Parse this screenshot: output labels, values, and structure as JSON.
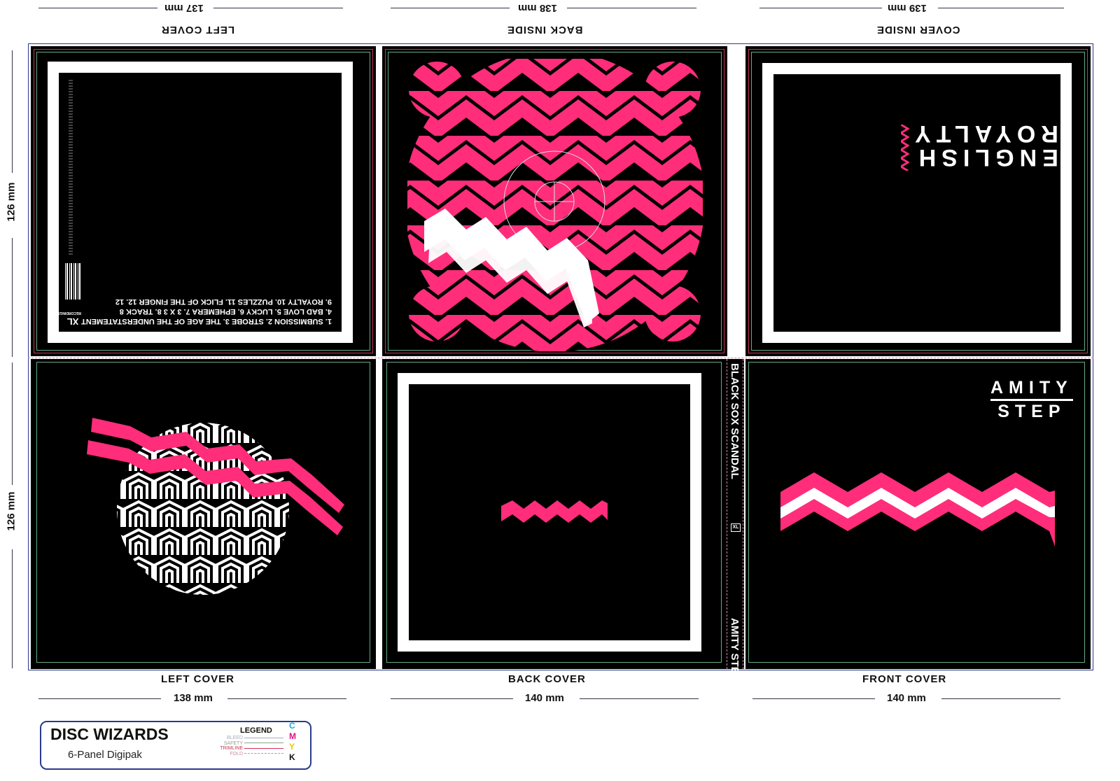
{
  "dimensions": {
    "top": [
      "137 mm",
      "138 mm",
      "139 mm"
    ],
    "bottom": [
      "138 mm",
      "140 mm",
      "140 mm"
    ],
    "side": [
      "126 mm",
      "126 mm"
    ]
  },
  "panel_labels": {
    "top": [
      "LEFT COVER",
      "BACK INSIDE",
      "COVER  INSIDE"
    ],
    "bottom": [
      "LEFT COVER",
      "BACK COVER",
      "FRONT COVER"
    ]
  },
  "tracklist": [
    "1. SUBMISSION   2. STROBE   3. THE AGE OF THE UNDERSTATEMENT",
    "4. BAD LOVE  5. LUCKY  6. EPHEMERA   7. 3 X 3   8. TRACK 8",
    "9. ROYALTY   10. PUZZLES   11. FLICK OF THE FINGER   12. 12"
  ],
  "label_mark": "XL",
  "label_sub": "RECORDINGS",
  "inside_title": [
    "ENGLISH",
    "ROYALTY"
  ],
  "spine": {
    "artist_top": "BLACK SOX SCANDAL",
    "logo": "XL",
    "title_bottom": "AMITY STEP"
  },
  "front_title": [
    "AMITY",
    "STEP"
  ],
  "legend": {
    "brand": "DISC WIZARDS",
    "product": "6-Panel Digipak",
    "heading": "LEGEND",
    "items": [
      "BLEED",
      "SAFETY",
      "TRIMLINE",
      "FOLD"
    ],
    "cmyk": [
      "C",
      "M",
      "Y",
      "K"
    ]
  },
  "colors": {
    "pink": "#ff2d7a",
    "black": "#000000",
    "white": "#ffffff",
    "cyan": "#1aa7d9",
    "magenta": "#e0137b",
    "yellow": "#e6c70a",
    "key": "#111111"
  }
}
